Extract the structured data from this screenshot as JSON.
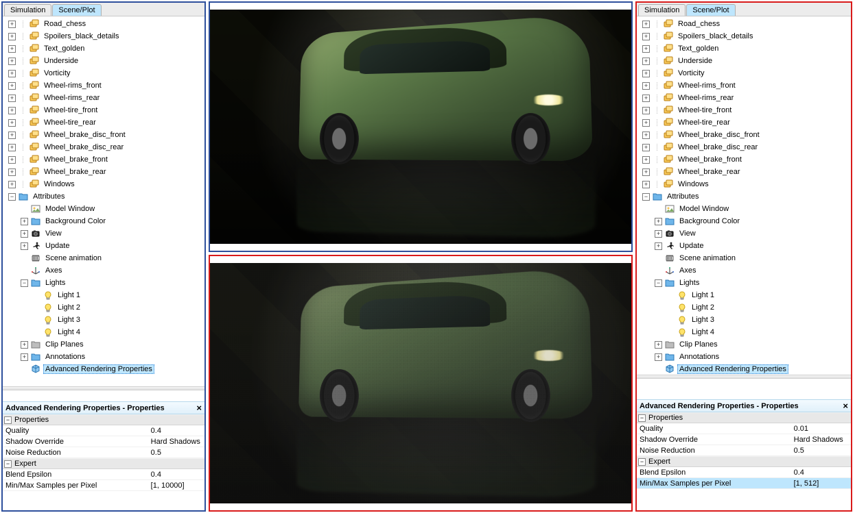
{
  "tabs": {
    "simulation": "Simulation",
    "scene_plot": "Scene/Plot"
  },
  "tree": {
    "items": [
      {
        "label": "Road_chess",
        "icon": "layer",
        "depth": 0,
        "exp": "+",
        "dots": true
      },
      {
        "label": "Spoilers_black_details",
        "icon": "layer",
        "depth": 0,
        "exp": "+",
        "dots": true
      },
      {
        "label": "Text_golden",
        "icon": "layer",
        "depth": 0,
        "exp": "+",
        "dots": true
      },
      {
        "label": "Underside",
        "icon": "layer",
        "depth": 0,
        "exp": "+",
        "dots": true
      },
      {
        "label": "Vorticity",
        "icon": "layer",
        "depth": 0,
        "exp": "+",
        "dots": true
      },
      {
        "label": "Wheel-rims_front",
        "icon": "layer",
        "depth": 0,
        "exp": "+",
        "dots": true
      },
      {
        "label": "Wheel-rims_rear",
        "icon": "layer",
        "depth": 0,
        "exp": "+",
        "dots": true
      },
      {
        "label": "Wheel-tire_front",
        "icon": "layer",
        "depth": 0,
        "exp": "+",
        "dots": true
      },
      {
        "label": "Wheel-tire_rear",
        "icon": "layer",
        "depth": 0,
        "exp": "+",
        "dots": true
      },
      {
        "label": "Wheel_brake_disc_front",
        "icon": "layer",
        "depth": 0,
        "exp": "+",
        "dots": true
      },
      {
        "label": "Wheel_brake_disc_rear",
        "icon": "layer",
        "depth": 0,
        "exp": "+",
        "dots": true
      },
      {
        "label": "Wheel_brake_front",
        "icon": "layer",
        "depth": 0,
        "exp": "+",
        "dots": true
      },
      {
        "label": "Wheel_brake_rear",
        "icon": "layer",
        "depth": 0,
        "exp": "+",
        "dots": true
      },
      {
        "label": "Windows",
        "icon": "layer",
        "depth": 0,
        "exp": "+",
        "dots": true
      },
      {
        "label": "Attributes",
        "icon": "folder",
        "depth": 0,
        "exp": "−",
        "dots": false
      },
      {
        "label": "Model Window",
        "icon": "image",
        "depth": 1,
        "exp": "",
        "dots": false
      },
      {
        "label": "Background Color",
        "icon": "folder",
        "depth": 1,
        "exp": "+",
        "dots": false
      },
      {
        "label": "View",
        "icon": "camera",
        "depth": 1,
        "exp": "+",
        "dots": false
      },
      {
        "label": "Update",
        "icon": "runner",
        "depth": 1,
        "exp": "+",
        "dots": false
      },
      {
        "label": "Scene animation",
        "icon": "film",
        "depth": 1,
        "exp": "",
        "dots": false
      },
      {
        "label": "Axes",
        "icon": "axes",
        "depth": 1,
        "exp": "",
        "dots": false
      },
      {
        "label": "Lights",
        "icon": "folder",
        "depth": 1,
        "exp": "−",
        "dots": false
      },
      {
        "label": "Light 1",
        "icon": "bulb",
        "depth": 2,
        "exp": "",
        "dots": false
      },
      {
        "label": "Light 2",
        "icon": "bulb",
        "depth": 2,
        "exp": "",
        "dots": false
      },
      {
        "label": "Light 3",
        "icon": "bulb",
        "depth": 2,
        "exp": "",
        "dots": false
      },
      {
        "label": "Light 4",
        "icon": "bulb",
        "depth": 2,
        "exp": "",
        "dots": false
      },
      {
        "label": "Clip Planes",
        "icon": "folder-gray",
        "depth": 1,
        "exp": "+",
        "dots": false
      },
      {
        "label": "Annotations",
        "icon": "folder",
        "depth": 1,
        "exp": "+",
        "dots": false
      },
      {
        "label": "Advanced Rendering Properties",
        "icon": "cube",
        "depth": 1,
        "exp": "",
        "dots": false,
        "selected": true
      }
    ]
  },
  "props_title": "Advanced Rendering Properties - Properties",
  "sections": {
    "properties": "Properties",
    "expert": "Expert"
  },
  "left_props": [
    {
      "name": "Quality",
      "value": "0.4"
    },
    {
      "name": "Shadow Override",
      "value": "Hard Shadows"
    },
    {
      "name": "Noise Reduction",
      "value": "0.5"
    }
  ],
  "left_expert": [
    {
      "name": "Blend Epsilon",
      "value": "0.4"
    },
    {
      "name": "Min/Max Samples per Pixel",
      "value": "[1, 10000]"
    }
  ],
  "right_props": [
    {
      "name": "Quality",
      "value": "0.01"
    },
    {
      "name": "Shadow Override",
      "value": "Hard Shadows"
    },
    {
      "name": "Noise Reduction",
      "value": "0.5"
    }
  ],
  "right_expert": [
    {
      "name": "Blend Epsilon",
      "value": "0.4"
    },
    {
      "name": "Min/Max Samples per Pixel",
      "value": "[1, 512]",
      "selected": true
    }
  ]
}
